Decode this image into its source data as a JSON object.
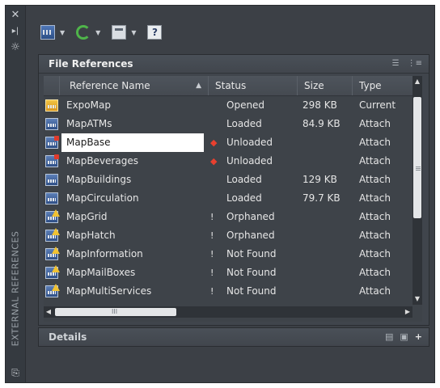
{
  "palette": {
    "title": "EXTERNAL REFERENCES",
    "close_icon": "close-icon",
    "autohide_icon": "autohide-icon",
    "properties_icon": "properties-icon",
    "bottom_icon": "palette-menu-icon"
  },
  "toolbar": {
    "buttons": [
      {
        "name": "attach-dwg-button",
        "icon": "attach-icon",
        "has_dropdown": true
      },
      {
        "name": "refresh-button",
        "icon": "refresh-icon",
        "has_dropdown": true
      },
      {
        "name": "change-path-button",
        "icon": "change-path-icon",
        "has_dropdown": true
      },
      {
        "name": "help-button",
        "icon": "help-icon",
        "has_dropdown": false
      }
    ]
  },
  "file_references": {
    "title": "File References",
    "list_view_icon": "list-view-icon",
    "tree_view_icon": "tree-view-icon",
    "columns": [
      "Reference Name",
      "Status",
      "Size",
      "Type"
    ],
    "sorted_column": "Reference Name",
    "sort_direction": "ascending",
    "selected_row": 2,
    "rows": [
      {
        "name": "ExpoMap",
        "icon": "current",
        "flag": "",
        "status": "Opened",
        "size": "298 KB",
        "type": "Current"
      },
      {
        "name": "MapATMs",
        "icon": "attach",
        "flag": "",
        "status": "Loaded",
        "size": "84.9 KB",
        "type": "Attach"
      },
      {
        "name": "MapBase",
        "icon": "unloaded",
        "flag": "red",
        "status": "Unloaded",
        "size": "",
        "type": "Attach"
      },
      {
        "name": "MapBeverages",
        "icon": "unloaded",
        "flag": "red",
        "status": "Unloaded",
        "size": "",
        "type": "Attach"
      },
      {
        "name": "MapBuildings",
        "icon": "attach",
        "flag": "",
        "status": "Loaded",
        "size": "129 KB",
        "type": "Attach"
      },
      {
        "name": "MapCirculation",
        "icon": "attach",
        "flag": "",
        "status": "Loaded",
        "size": "79.7 KB",
        "type": "Attach"
      },
      {
        "name": "MapGrid",
        "icon": "warn",
        "flag": "white",
        "status": "Orphaned",
        "size": "",
        "type": "Attach"
      },
      {
        "name": "MapHatch",
        "icon": "warn",
        "flag": "white",
        "status": "Orphaned",
        "size": "",
        "type": "Attach"
      },
      {
        "name": "MapInformation",
        "icon": "warn",
        "flag": "white",
        "status": "Not Found",
        "size": "",
        "type": "Attach"
      },
      {
        "name": "MapMailBoxes",
        "icon": "warn",
        "flag": "white",
        "status": "Not Found",
        "size": "",
        "type": "Attach"
      },
      {
        "name": "MapMultiServices",
        "icon": "warn",
        "flag": "white",
        "status": "Not Found",
        "size": "",
        "type": "Attach"
      }
    ],
    "hscroll_grip": "III"
  },
  "details": {
    "title": "Details",
    "icons": [
      "details-view-icon",
      "preview-icon",
      "expand-icon"
    ]
  },
  "colors": {
    "background": "#3c4046",
    "panel": "#40454c",
    "selected_row": "#ffffff",
    "error_flag": "#e8402f",
    "refresh": "#4fb54a"
  }
}
